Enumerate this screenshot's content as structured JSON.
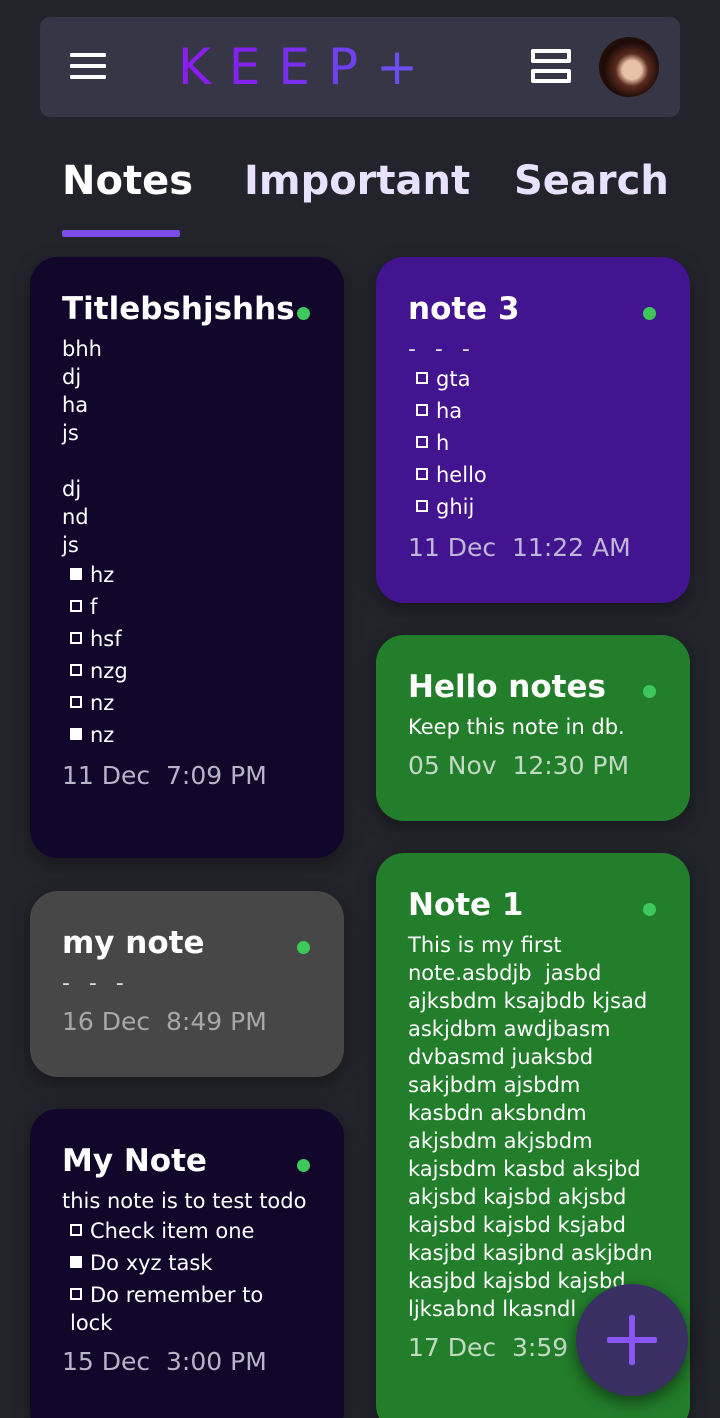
{
  "app": {
    "logo": {
      "k": "K",
      "e1": "E",
      "e2": "E",
      "p": "P",
      "plus": "+"
    }
  },
  "tabs": [
    {
      "label": "Notes",
      "active": true
    },
    {
      "label": "Important",
      "active": false
    },
    {
      "label": "Search",
      "active": false
    }
  ],
  "notes": {
    "n1": {
      "title": "Titlebshjshhs",
      "body": "bhh\ndj\nha\njs\n\ndj\nnd\njs\n",
      "checklist": [
        {
          "text": "hz",
          "checked": true
        },
        {
          "text": "f",
          "checked": false
        },
        {
          "text": "hsf",
          "checked": false
        },
        {
          "text": "nzg",
          "checked": false
        },
        {
          "text": "nz",
          "checked": false
        },
        {
          "text": "nz",
          "checked": true
        }
      ],
      "date": "11 Dec  7:09 PM"
    },
    "n2": {
      "title": "note 3",
      "dashes": "- - -",
      "checklist": [
        {
          "text": "gta",
          "checked": false
        },
        {
          "text": "ha",
          "checked": false
        },
        {
          "text": "h",
          "checked": false
        },
        {
          "text": "hello",
          "checked": false
        },
        {
          "text": "ghij",
          "checked": false
        }
      ],
      "date": "11 Dec  11:22 AM"
    },
    "n3": {
      "title": "Hello notes",
      "body": "Keep this note in db.",
      "date": "05 Nov  12:30 PM"
    },
    "n4": {
      "title": "my note",
      "dashes": "- - -",
      "date": "16 Dec  8:49 PM"
    },
    "n5": {
      "title": "Note 1",
      "body": "This is my first note.asbdjb  jasbd ajksbdm ksajbdb kjsad askjdbm awdjbasm dvbasmd juaksbd sakjbdm ajsbdm kasbdn aksbndm akjsbdm akjsbdm kajsbdm kasbd aksjbd akjsbd kajsbd akjsbd kajsbd kajsbd ksjabd kasjbd kasjbnd askjbdn kasjbd kajsbd kajsbd ljksabnd lkasndl",
      "date": "17 Dec  3:59 PM"
    },
    "n6": {
      "title": "My Note",
      "body": "this note is to test todo",
      "checklist": [
        {
          "text": "Check item one",
          "checked": false
        },
        {
          "text": "Do xyz task",
          "checked": true
        },
        {
          "text": "Do remember to lock",
          "checked": false
        }
      ],
      "date": "15 Dec  3:00 PM"
    }
  },
  "fab": {
    "label": "+"
  },
  "colors": {
    "background": "#23232b",
    "appbar": "#363646",
    "accent": "#7b4ce8",
    "dark_card": "#12062b",
    "purple_card": "#42148f",
    "green_card": "#227e2a",
    "grey_card": "#474747",
    "status_dot": "#3cc85a"
  },
  "icons": {
    "menu": "menu-icon",
    "layout": "view-stream-icon",
    "add": "add-icon",
    "avatar": "user-avatar"
  }
}
